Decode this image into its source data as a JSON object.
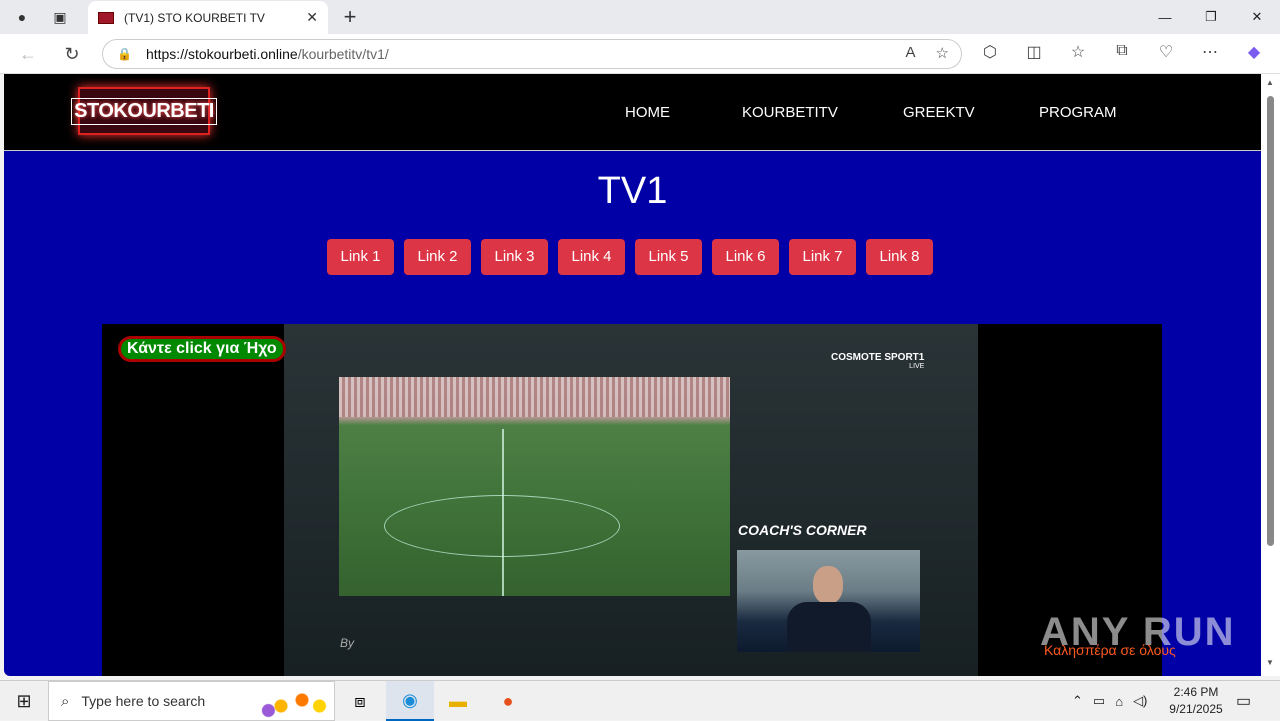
{
  "browser": {
    "tab_title": "(TV1) STO KOURBETI TV",
    "tab_close": "✕",
    "new_tab": "+",
    "url_host": "https://stokourbeti.online",
    "url_path": "/kourbetitv/tv1/",
    "window_controls": {
      "minimize": "—",
      "maximize": "❐",
      "close": "✕"
    }
  },
  "site": {
    "logo_text": "STOKOURBETI",
    "nav": [
      "HOME",
      "KOURBETITV",
      "GREEKTV",
      "PROGRAM"
    ],
    "page_title": "TV1",
    "links": [
      "Link 1",
      "Link 2",
      "Link 3",
      "Link 4",
      "Link 5",
      "Link 6",
      "Link 7",
      "Link 8"
    ],
    "sound_button": "Κάντε click για Ήχο",
    "ticker": "Καλησπέρα σε όλους"
  },
  "video": {
    "brand": "COSMOTE SPORT1",
    "brand_sub": "LIVE",
    "coach_caption": "COACH'S CORNER",
    "byline": "By"
  },
  "overlay": {
    "watermark": "ANY RUN"
  },
  "taskbar": {
    "search_placeholder": "Type here to search",
    "time": "2:46 PM",
    "date": "9/21/2025"
  }
}
